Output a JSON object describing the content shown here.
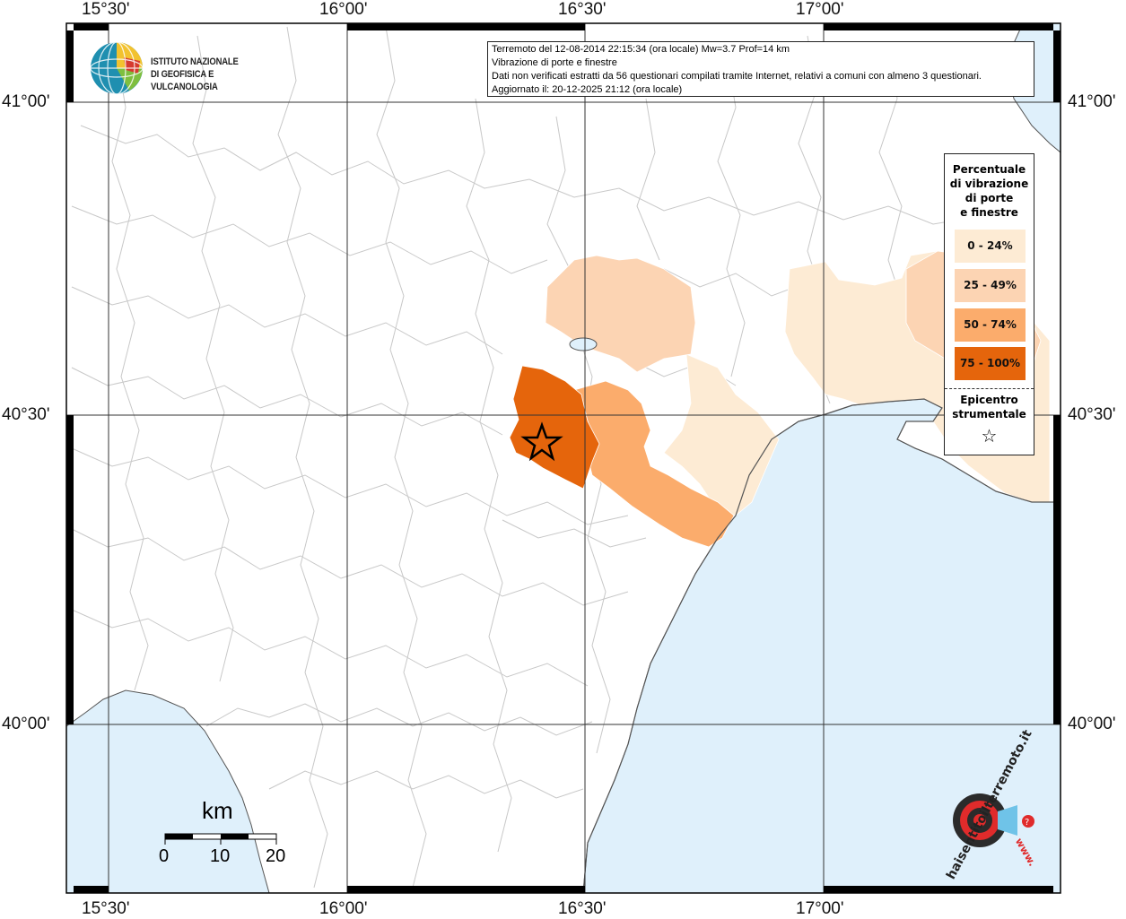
{
  "map": {
    "lon_labels": [
      "15°30'",
      "16°00'",
      "16°30'",
      "17°00'"
    ],
    "lat_labels": [
      "41°00'",
      "40°30'",
      "40°00'"
    ],
    "colors": {
      "sea": "#dff0fb",
      "land": "#ffffff",
      "class_0_24": "#fdebd4",
      "class_25_49": "#fcd4b3",
      "class_50_74": "#fbac6c",
      "class_75_100": "#e5650c",
      "borders": "#c8c8c8",
      "coast": "#555555"
    }
  },
  "info": {
    "line1": "Terremoto del 12-08-2014 22:15:34 (ora locale) Mw=3.7 Prof=14 km",
    "line2": "Vibrazione di porte e finestre",
    "line3": "Dati non verificati estratti da 56 questionari compilati tramite Internet, relativi a comuni con almeno 3 questionari.",
    "line4": "Aggiornato il: 20-12-2025 21:12 (ora locale)"
  },
  "logo": {
    "line1": "ISTITUTO NAZIONALE",
    "line2": "DI GEOFISICA E VULCANOLOGIA"
  },
  "legend": {
    "title": [
      "Percentuale",
      "di vibrazione",
      "di porte",
      "e finestre"
    ],
    "items": [
      {
        "label": "0 - 24%",
        "color": "#fdebd4"
      },
      {
        "label": "25 - 49%",
        "color": "#fcd4b3"
      },
      {
        "label": "50 - 74%",
        "color": "#fbac6c"
      },
      {
        "label": "75 - 100%",
        "color": "#e5650c"
      }
    ],
    "epicenter": [
      "Epicentro",
      "strumentale"
    ],
    "epicenter_symbol": "☆"
  },
  "scale": {
    "unit": "km",
    "ticks": [
      "0",
      "10",
      "20"
    ]
  },
  "badge": {
    "text": "haisentitoilterremoto.it",
    "url_text": "www."
  }
}
